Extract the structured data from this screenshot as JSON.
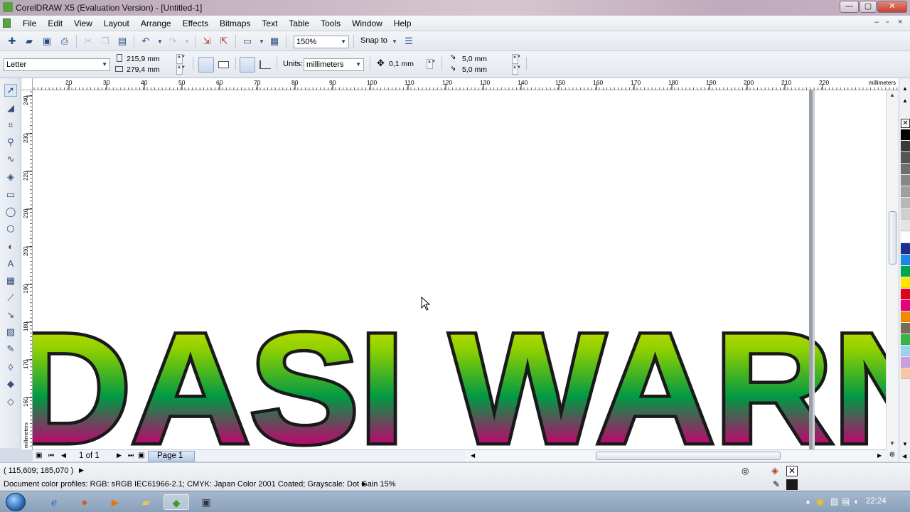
{
  "window": {
    "title": "CorelDRAW X5 (Evaluation Version) - [Untitled-1]",
    "minimize": "—",
    "restore": "▢",
    "close": "✕"
  },
  "menubar": {
    "items": [
      "File",
      "Edit",
      "View",
      "Layout",
      "Arrange",
      "Effects",
      "Bitmaps",
      "Text",
      "Table",
      "Tools",
      "Window",
      "Help"
    ],
    "doc_minimize": "–",
    "doc_restore": "▫",
    "doc_close": "×"
  },
  "toolbar": {
    "zoom_value": "150%",
    "snap_to_label": "Snap to"
  },
  "property_bar": {
    "page_size": "Letter",
    "width": "215,9 mm",
    "height": "279,4 mm",
    "units_label": "Units:",
    "units_value": "millimeters",
    "nudge": "0,1 mm",
    "dup_x": "5,0 mm",
    "dup_y": "5,0 mm"
  },
  "ruler": {
    "unit": "millimeters",
    "top_labels": [
      "20",
      "30",
      "40",
      "50",
      "60",
      "70",
      "80",
      "90",
      "100",
      "110",
      "120",
      "130",
      "140",
      "150",
      "160",
      "170",
      "180",
      "190",
      "200",
      "210",
      "220"
    ],
    "left_labels": [
      "240",
      "230",
      "220",
      "210",
      "200",
      "190",
      "180",
      "170",
      "160"
    ],
    "left_unit": "millimeters"
  },
  "canvas": {
    "text": "DASI WARN",
    "gradient": [
      "#f2ee00",
      "#8dd000",
      "#009944",
      "#b0106a",
      "#e8005e"
    ],
    "outline_color": "#1a1a1a"
  },
  "navigation": {
    "page_counter": "1 of 1",
    "page_tab": "Page 1"
  },
  "status": {
    "cursor_position": "( 115,609; 185,070 )",
    "color_profiles": "Document color profiles: RGB: sRGB IEC61966-2.1; CMYK: Japan Color 2001 Coated; Grayscale: Dot Gain 15%"
  },
  "palette": [
    "#000000",
    "#3a3a3a",
    "#555555",
    "#6e6e6e",
    "#878787",
    "#a0a0a0",
    "#b8b8b8",
    "#cfcfcf",
    "#e3e3e3",
    "#ffffff",
    "#1c2f8f",
    "#1e88e5",
    "#00a651",
    "#ffe600",
    "#e2001a",
    "#e6007e",
    "#f08a00",
    "#7d6b5a",
    "#38b54a",
    "#9ad2f0",
    "#c9a0dc",
    "#f7c8a0"
  ],
  "taskbar": {
    "clock": "22:24"
  }
}
